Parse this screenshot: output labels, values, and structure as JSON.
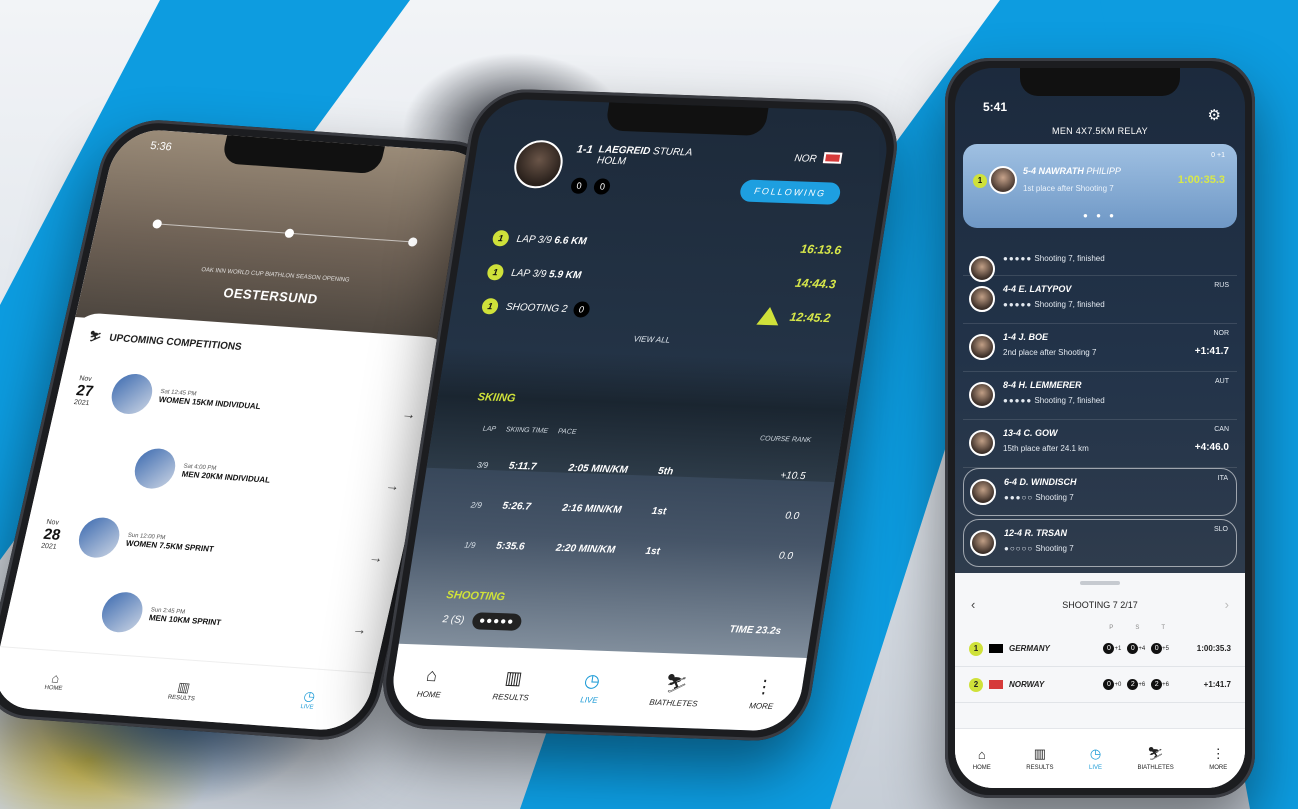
{
  "colors": {
    "accent": "#1b9ad6",
    "lime": "#cfe13a",
    "stripe": "#0d9ce0"
  },
  "phone1": {
    "time": "5:36",
    "header_sub": "OAK INN WORLD CUP BIATHLON SEASON OPENING",
    "venue": "OESTERSUND",
    "section_title": "UPCOMING COMPETITIONS",
    "competitions": [
      {
        "month": "Nov",
        "day": "27",
        "year": "2021",
        "time": "Sat 12:45 PM",
        "title": "WOMEN 15KM INDIVIDUAL"
      },
      {
        "month": "",
        "day": "",
        "year": "",
        "time": "Sat 4:00 PM",
        "title": "MEN 20KM INDIVIDUAL"
      },
      {
        "month": "Nov",
        "day": "28",
        "year": "2021",
        "time": "Sun 12:00 PM",
        "title": "WOMEN 7.5KM SPRINT"
      },
      {
        "month": "",
        "day": "",
        "year": "",
        "time": "Sun 2:45 PM",
        "title": "MEN 10KM SPRINT"
      }
    ],
    "nav": [
      {
        "label": "HOME",
        "icon": "home-icon",
        "glyph": "⌂"
      },
      {
        "label": "RESULTS",
        "icon": "podium-icon",
        "glyph": "▥"
      },
      {
        "label": "LIVE",
        "icon": "live-icon",
        "glyph": "◷"
      }
    ]
  },
  "phone2": {
    "rank": "1-1",
    "last_name": "LAEGREID",
    "first_name": "STURLA HOLM",
    "nation": "NOR",
    "penalties": [
      "0",
      "0"
    ],
    "follow_label": "FOLLOWING",
    "laps": [
      {
        "badge": "1",
        "label": "LAP 3/9",
        "distance": "6.6 KM",
        "time": "16:13.6"
      },
      {
        "badge": "1",
        "label": "LAP 3/9",
        "distance": "5.9 KM",
        "time": "14:44.3"
      },
      {
        "badge": "1",
        "label": "SHOOTING 2",
        "distance": "0",
        "time": "12:45.2"
      }
    ],
    "view_all": "VIEW ALL",
    "skiing_title": "SKIING",
    "skiing_cols": [
      "LAP",
      "SKIING TIME",
      "PACE",
      "COURSE RANK"
    ],
    "skiing_rows": [
      {
        "lap": "3/9",
        "time": "5:11.7",
        "pace": "2:05 MIN/KM",
        "rank": "5th",
        "diff": "+10.5"
      },
      {
        "lap": "2/9",
        "time": "5:26.7",
        "pace": "2:16 MIN/KM",
        "rank": "1st",
        "diff": "0.0"
      },
      {
        "lap": "1/9",
        "time": "5:35.6",
        "pace": "2:20 MIN/KM",
        "rank": "1st",
        "diff": "0.0"
      }
    ],
    "shooting_title": "SHOOTING",
    "shooting_stage": "2 (S)",
    "shooting_targets": "●●●●●",
    "shooting_time": "TIME 23.2s",
    "nav": [
      {
        "label": "HOME",
        "icon": "home-icon",
        "glyph": "⌂"
      },
      {
        "label": "RESULTS",
        "icon": "podium-icon",
        "glyph": "▥"
      },
      {
        "label": "LIVE",
        "icon": "live-icon",
        "glyph": "◷"
      },
      {
        "label": "BIATHLETES",
        "icon": "biathlete-icon",
        "glyph": "⛷"
      },
      {
        "label": "MORE",
        "icon": "more-icon",
        "glyph": "⋮"
      }
    ]
  },
  "phone3": {
    "time": "5:41",
    "title": "MEN 4X7.5KM RELAY",
    "featured": {
      "badge": "1",
      "rank": "5-4",
      "last_name": "NAWRATH",
      "first_name": "PHILIPP",
      "status": "1st place after Shooting 7",
      "time": "1:00:35.3",
      "pill": "0 +1",
      "dots": "● ● ●"
    },
    "athletes": [
      {
        "rank": "",
        "name": "",
        "status_dots": "●●●●●",
        "status": "Shooting 7, finished",
        "nation": "",
        "time": "",
        "framed": false
      },
      {
        "rank": "4-4",
        "name": "E. LATYPOV",
        "status_dots": "●●●●●",
        "status": "Shooting 7, finished",
        "nation": "RUS",
        "time": "",
        "framed": false
      },
      {
        "rank": "1-4",
        "name": "J. BOE",
        "status_dots": "",
        "status": "2nd place after Shooting 7",
        "nation": "NOR",
        "time": "+1:41.7",
        "framed": false
      },
      {
        "rank": "8-4",
        "name": "H. LEMMERER",
        "status_dots": "●●●●●",
        "status": "Shooting 7, finished",
        "nation": "AUT",
        "time": "",
        "framed": false
      },
      {
        "rank": "13-4",
        "name": "C. GOW",
        "status_dots": "",
        "status": "15th place after 24.1 km",
        "nation": "CAN",
        "time": "+4:46.0",
        "framed": false
      },
      {
        "rank": "6-4",
        "name": "D. WINDISCH",
        "status_dots": "●●●○○",
        "status": "Shooting 7",
        "nation": "ITA",
        "time": "",
        "framed": true
      },
      {
        "rank": "12-4",
        "name": "R. TRSAN",
        "status_dots": "●○○○○",
        "status": "Shooting 7",
        "nation": "SLO",
        "time": "",
        "framed": true
      }
    ],
    "shooting_header": "SHOOTING 7 2/17",
    "pst": [
      "P",
      "S",
      "T"
    ],
    "teams": [
      {
        "pos": "1",
        "name": "GERMANY",
        "p": "0",
        "p_add": "+1",
        "s": "0",
        "s_add": "+4",
        "t": "0",
        "t_add": "+5",
        "time": "1:00:35.3",
        "flag": "#000000"
      },
      {
        "pos": "2",
        "name": "NORWAY",
        "p": "0",
        "p_add": "+0",
        "s": "2",
        "s_add": "+6",
        "t": "2",
        "t_add": "+6",
        "time": "+1:41.7",
        "flag": "#d63a3a"
      }
    ],
    "nav": [
      {
        "label": "HOME",
        "icon": "home-icon",
        "glyph": "⌂"
      },
      {
        "label": "RESULTS",
        "icon": "podium-icon",
        "glyph": "▥"
      },
      {
        "label": "LIVE",
        "icon": "live-icon",
        "glyph": "◷"
      },
      {
        "label": "BIATHLETES",
        "icon": "biathlete-icon",
        "glyph": "⛷"
      },
      {
        "label": "MORE",
        "icon": "more-icon",
        "glyph": "⋮"
      }
    ]
  }
}
